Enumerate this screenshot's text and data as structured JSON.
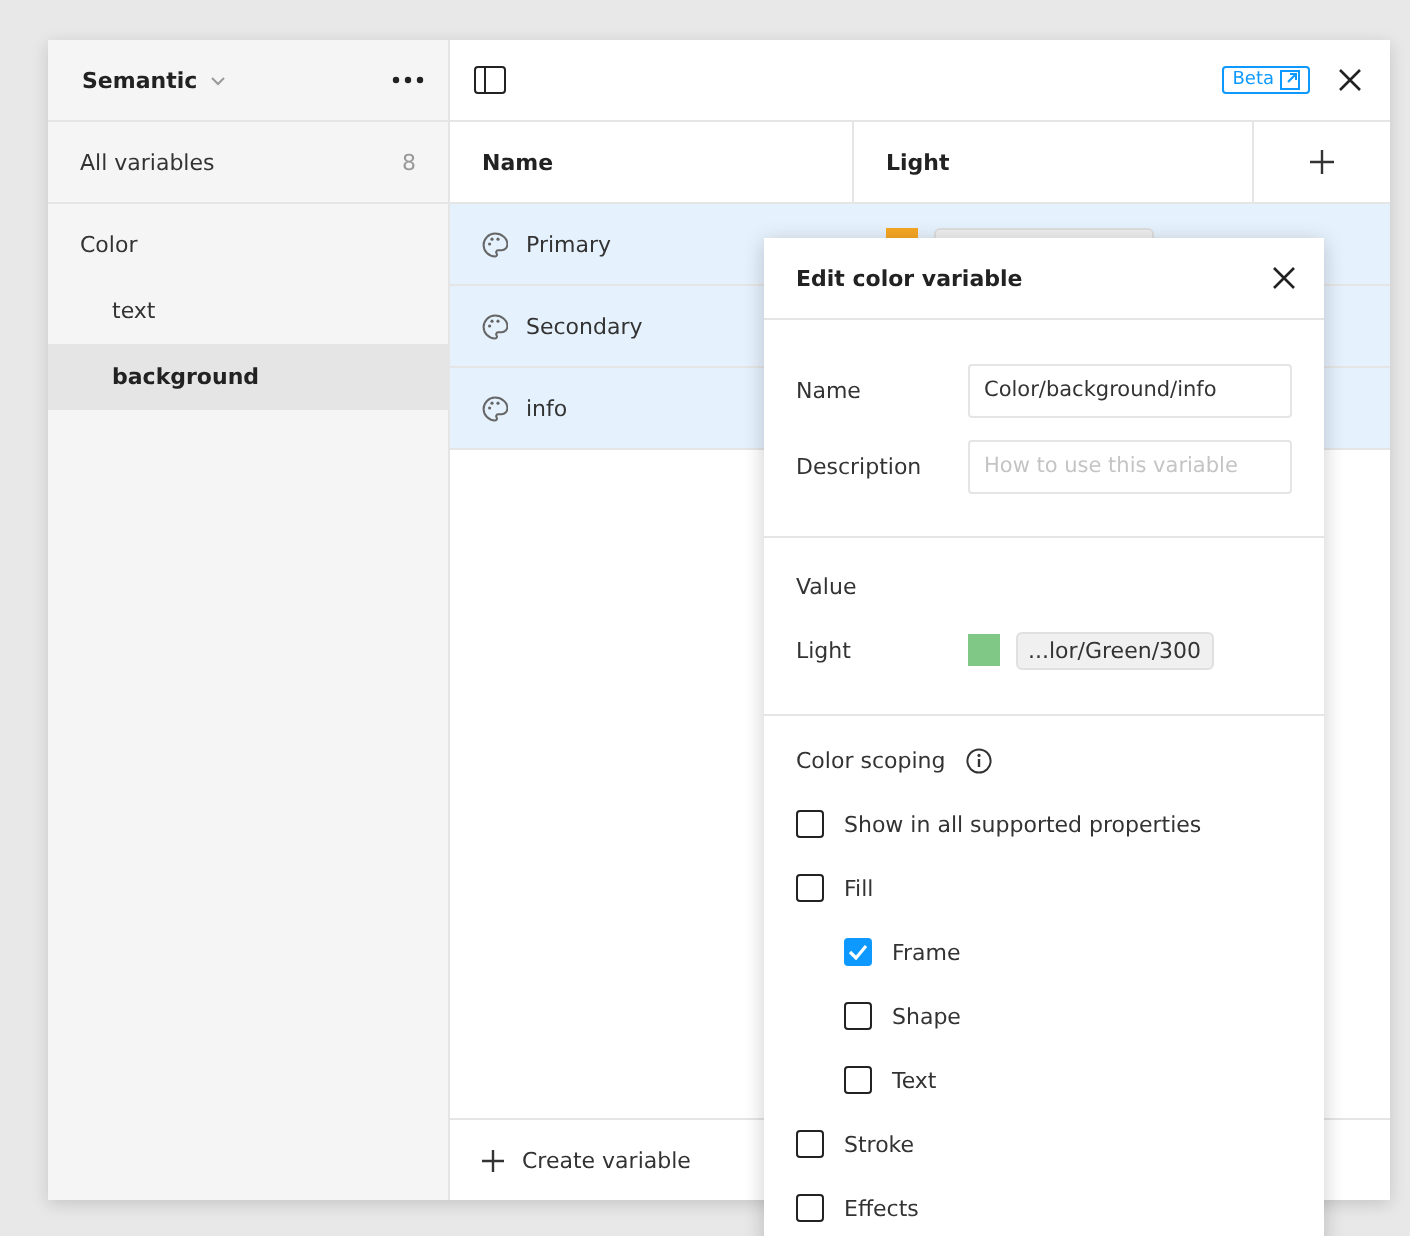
{
  "sidebar": {
    "collection": "Semantic",
    "all_variables": {
      "label": "All variables",
      "count": "8"
    },
    "groups": [
      {
        "label": "Color",
        "selected": false,
        "children": [
          {
            "label": "text",
            "selected": false
          },
          {
            "label": "background",
            "selected": true
          }
        ]
      }
    ]
  },
  "toolbar": {
    "beta_badge": "Beta"
  },
  "table": {
    "columns": [
      "Name",
      "Light"
    ],
    "rows": [
      {
        "name": "Primary",
        "selected": true,
        "color": "#f5a623"
      },
      {
        "name": "Secondary",
        "selected": true
      },
      {
        "name": "info",
        "selected": true
      }
    ],
    "create_button": "Create variable"
  },
  "dialog": {
    "title": "Edit color variable",
    "fields": [
      {
        "label": "Name",
        "value": "Color/background/info"
      },
      {
        "label": "Description",
        "placeholder": "How to use this variable"
      }
    ],
    "value_section": {
      "title": "Value",
      "mode": "Light",
      "color": "#80c885",
      "token": "...lor/Green/300"
    },
    "scoping": {
      "title": "Color scoping",
      "options": [
        {
          "label": "Show in all supported properties",
          "checked": false
        },
        {
          "label": "Fill",
          "checked": false,
          "children": [
            {
              "label": "Frame",
              "checked": true
            },
            {
              "label": "Shape",
              "checked": false
            },
            {
              "label": "Text",
              "checked": false
            }
          ]
        },
        {
          "label": "Stroke",
          "checked": false
        },
        {
          "label": "Effects",
          "checked": false
        }
      ]
    }
  }
}
